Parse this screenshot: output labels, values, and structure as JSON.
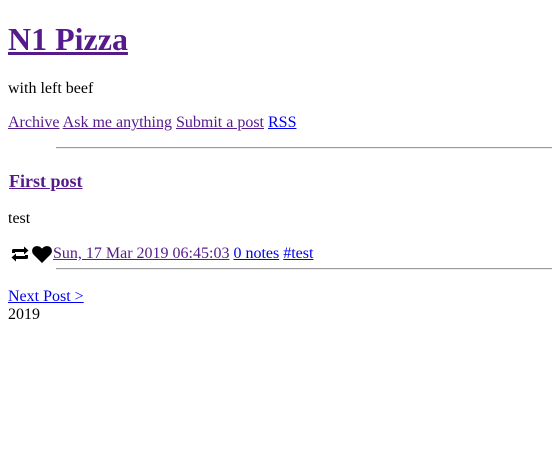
{
  "blog": {
    "title": "N1 Pizza",
    "description": "with left beef"
  },
  "nav": {
    "archive": "Archive",
    "ask": "Ask me anything",
    "submit": "Submit a post",
    "rss": "RSS"
  },
  "post": {
    "title": "First post",
    "body": "test",
    "date": "Sun, 17 Mar 2019 06:45:03",
    "notes": "0 notes",
    "tag": "#test",
    "icons": [
      "reblog-icon",
      "like-icon"
    ]
  },
  "pagination": {
    "next": "Next Post >"
  },
  "footer": {
    "year": "2019"
  },
  "colors": {
    "visited_link": "#551a8b",
    "link": "#0000ee",
    "text": "#000000",
    "background": "#ffffff"
  }
}
